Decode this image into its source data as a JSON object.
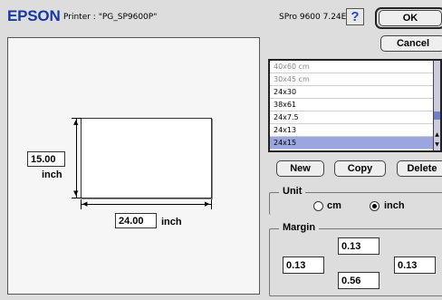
{
  "header": {
    "brand": "EPSON",
    "printer": "Printer : \"PG_SP9600P\"",
    "version": "SPro 9600 7.24E",
    "help_label": "?"
  },
  "buttons": {
    "ok": "OK",
    "cancel": "Cancel",
    "new": "New",
    "copy": "Copy",
    "delete": "Delete"
  },
  "preview": {
    "height_value": "15.00",
    "height_unit": "inch",
    "width_value": "24.00",
    "width_unit": "inch"
  },
  "paper_list": {
    "items": [
      "40x60 cm",
      "30x45 cm",
      "24x30",
      "38x61",
      "24x7.5",
      "24x13",
      "24x15"
    ],
    "disabled_count": 2,
    "selected_index": 6
  },
  "unit": {
    "title": "Unit",
    "options": [
      "cm",
      "inch"
    ],
    "selected": "inch"
  },
  "margin": {
    "title": "Margin",
    "top": "0.13",
    "left": "0.13",
    "right": "0.13",
    "bottom": "0.56"
  },
  "colors": {
    "brand": "#1538a8",
    "selection": "#9aa6e0"
  }
}
